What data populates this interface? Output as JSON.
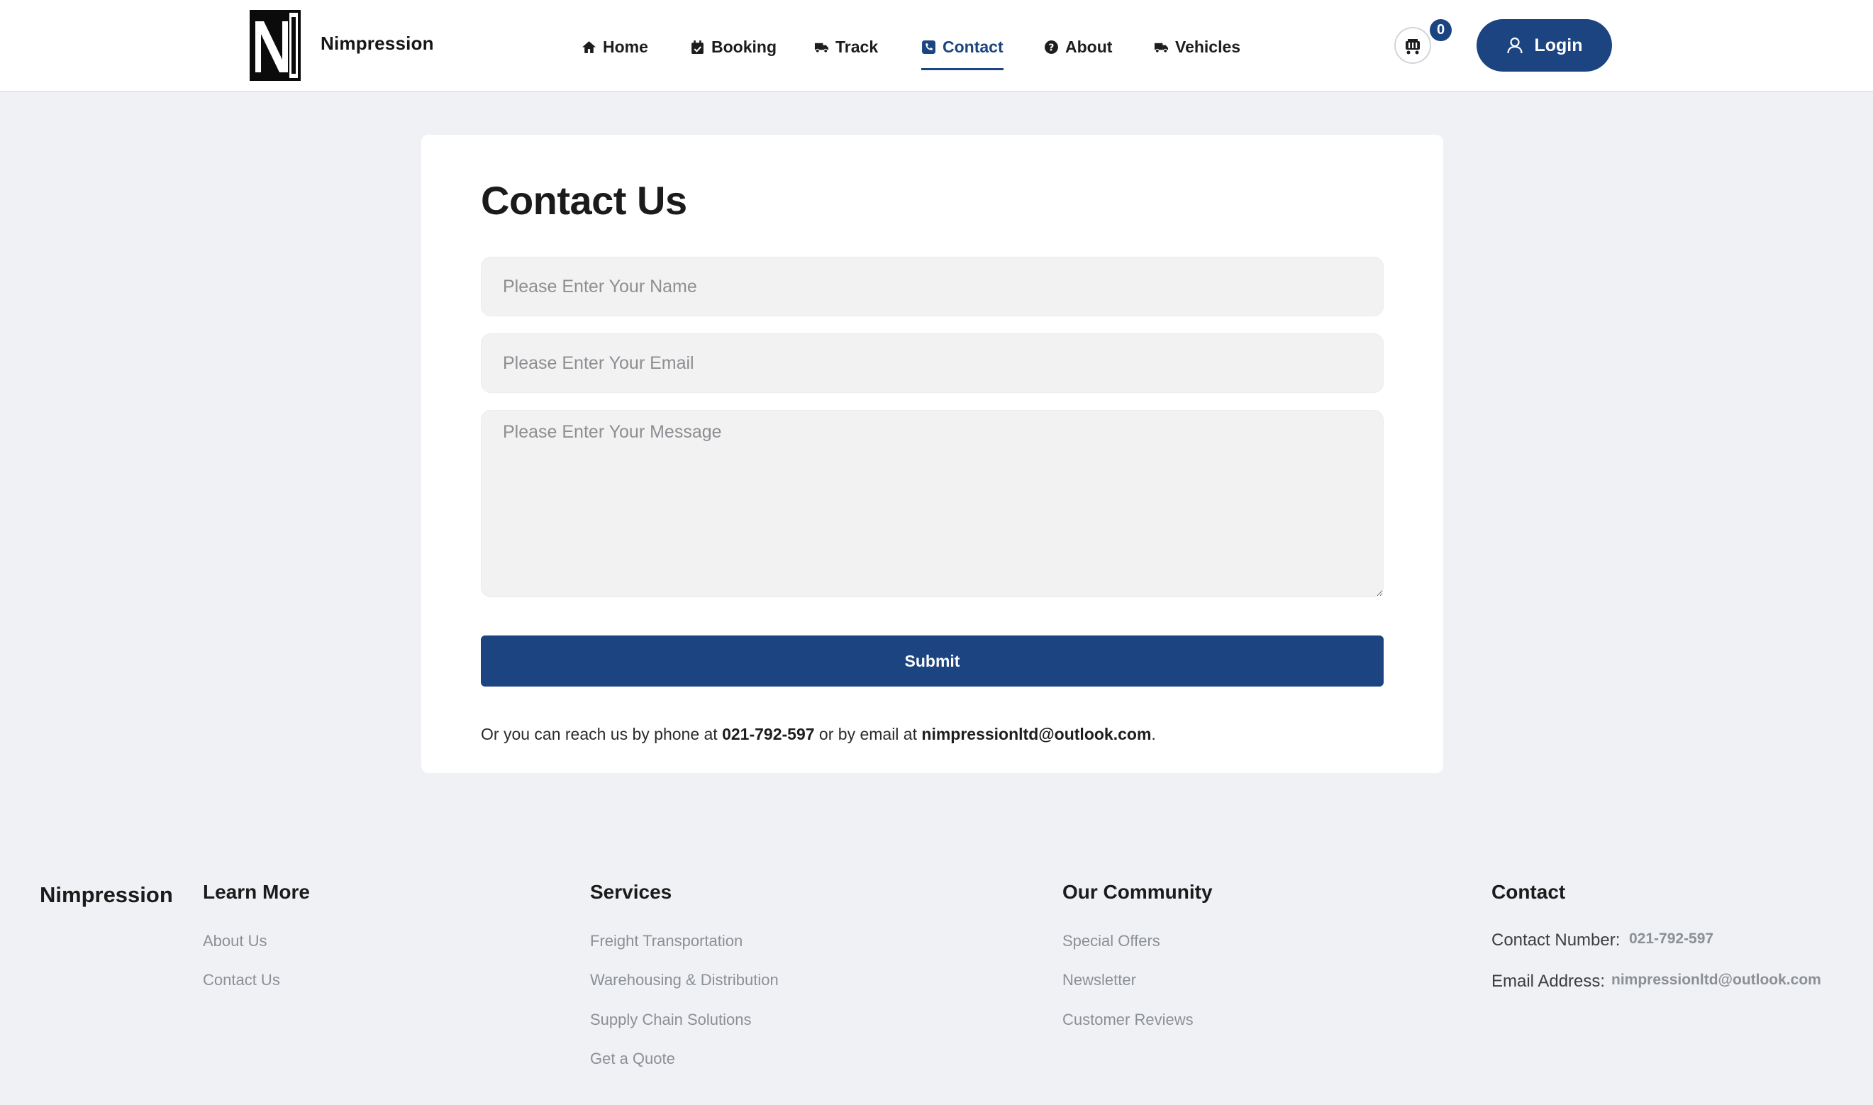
{
  "header": {
    "brand": "Nimpression",
    "nav": [
      {
        "label": "Home",
        "icon": "home-icon"
      },
      {
        "label": "Booking",
        "icon": "calendar-icon"
      },
      {
        "label": "Track",
        "icon": "truck-icon"
      },
      {
        "label": "Contact",
        "icon": "phone-icon",
        "active": true
      },
      {
        "label": "About",
        "icon": "question-circle-icon"
      },
      {
        "label": "Vehicles",
        "icon": "truck-icon"
      }
    ],
    "cart_count": "0",
    "login_label": "Login"
  },
  "contact_form": {
    "title": "Contact Us",
    "name_placeholder": "Please Enter Your Name",
    "email_placeholder": "Please Enter Your Email",
    "message_placeholder": "Please Enter Your Message",
    "submit_label": "Submit",
    "reach_prefix": "Or you can reach us by phone at ",
    "phone": "021-792-597",
    "reach_middle": " or by email at ",
    "email": "nimpressionltd@outlook.com",
    "reach_suffix": "."
  },
  "footer": {
    "brand": "Nimpression",
    "learn_more": {
      "title": "Learn More",
      "links": [
        "About Us",
        "Contact Us"
      ]
    },
    "services": {
      "title": "Services",
      "links": [
        "Freight Transportation",
        "Warehousing & Distribution",
        "Supply Chain Solutions",
        "Get a Quote"
      ]
    },
    "community": {
      "title": "Our Community",
      "links": [
        "Special Offers",
        "Newsletter",
        "Customer Reviews"
      ]
    },
    "contact": {
      "title": "Contact",
      "number_label": "Contact Number:",
      "number_value": "021-792-597",
      "email_label": "Email Address:",
      "email_value": "nimpressionltd@outlook.com"
    }
  },
  "colors": {
    "primary": "#1b4480",
    "background": "#f0f1f4",
    "muted_text": "#8b8f96"
  }
}
